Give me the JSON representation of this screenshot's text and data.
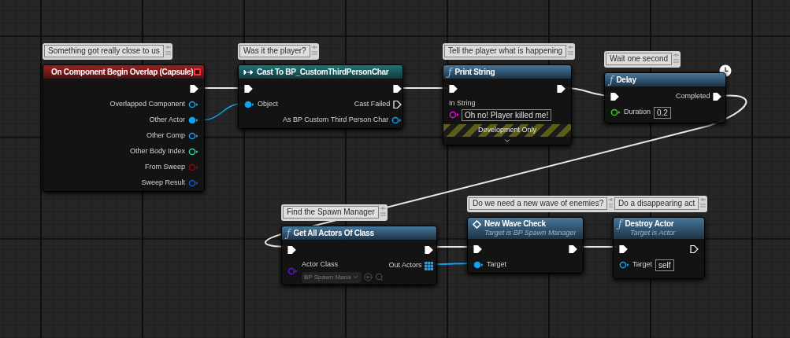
{
  "nodes": [
    {
      "comment": "Something got really close to us",
      "kind": "event",
      "title": "On Component Begin Overlap (Capsule)",
      "latent": false,
      "development_only": false,
      "outputs": [
        {
          "kind": "exec",
          "connected": true
        },
        {
          "kind": "object",
          "label": "Overlapped Component",
          "connected": false
        },
        {
          "kind": "object",
          "label": "Other Actor",
          "connected": true
        },
        {
          "kind": "object",
          "label": "Other Comp",
          "connected": false
        },
        {
          "kind": "int",
          "label": "Other Body Index",
          "connected": false
        },
        {
          "kind": "bool",
          "label": "From Sweep",
          "connected": false
        },
        {
          "kind": "struct",
          "label": "Sweep Result",
          "connected": false
        }
      ]
    },
    {
      "comment": "Was it the player?",
      "kind": "cast",
      "title": "Cast To BP_CustomThirdPersonChar",
      "latent": false,
      "development_only": false,
      "inputs": [
        {
          "kind": "exec",
          "connected": true
        },
        {
          "kind": "object",
          "label": "Object",
          "connected": true
        }
      ],
      "outputs": [
        {
          "kind": "exec",
          "connected": true
        },
        {
          "kind": "exec",
          "label": "Cast Failed",
          "connected": false
        },
        {
          "kind": "object",
          "label": "As BP Custom Third Person Char",
          "connected": false
        }
      ]
    },
    {
      "comment": "Tell the player what is happening",
      "kind": "function",
      "glyph": "ƒ",
      "title": "Print String",
      "latent": false,
      "development_only": true,
      "development_label": "Development Only",
      "inputs": [
        {
          "kind": "exec",
          "connected": true
        },
        {
          "kind": "string",
          "label": "In String",
          "connected": false,
          "value": "Oh no! Player killed me!"
        }
      ],
      "outputs": [
        {
          "kind": "exec",
          "connected": true
        }
      ]
    },
    {
      "comment": "Wait one second",
      "kind": "function",
      "glyph": "ƒ",
      "title": "Delay",
      "latent": true,
      "development_only": false,
      "inputs": [
        {
          "kind": "exec",
          "connected": true
        },
        {
          "kind": "float",
          "label": "Duration",
          "connected": false,
          "value": "0.2"
        }
      ],
      "outputs": [
        {
          "kind": "exec",
          "label": "Completed",
          "connected": true
        }
      ]
    },
    {
      "comment": "Find the Spawn Manager",
      "kind": "function",
      "glyph": "ƒ",
      "title": "Get All Actors Of Class",
      "latent": false,
      "development_only": false,
      "inputs": [
        {
          "kind": "exec",
          "connected": true
        },
        {
          "kind": "class",
          "label": "Actor Class",
          "connected": false,
          "value": "BP Spawn Mana"
        }
      ],
      "outputs": [
        {
          "kind": "exec",
          "connected": true
        },
        {
          "kind": "array",
          "label": "Out Actors",
          "connected": true
        }
      ]
    },
    {
      "comment": "Do we need a new wave of enemies?",
      "kind": "event-call",
      "title": "New Wave Check",
      "subtitle": "Target is BP Spawn Manager",
      "latent": false,
      "development_only": false,
      "inputs": [
        {
          "kind": "exec",
          "connected": true
        },
        {
          "kind": "object",
          "label": "Target",
          "connected": true
        }
      ],
      "outputs": [
        {
          "kind": "exec",
          "connected": true
        }
      ]
    },
    {
      "comment": "Do a disappearing act",
      "kind": "function",
      "glyph": "ƒ",
      "title": "Destroy Actor",
      "subtitle": "Target is Actor",
      "latent": false,
      "development_only": false,
      "inputs": [
        {
          "kind": "exec",
          "connected": true
        },
        {
          "kind": "object",
          "label": "Target",
          "connected": false,
          "value": "self"
        }
      ],
      "outputs": [
        {
          "kind": "exec",
          "connected": false
        }
      ]
    }
  ]
}
